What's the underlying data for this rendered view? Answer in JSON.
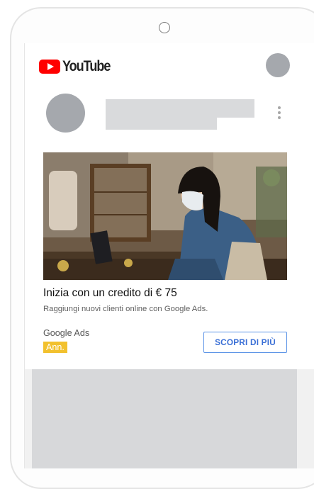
{
  "app": {
    "name": "YouTube"
  },
  "colors": {
    "brand_red": "#ff0000",
    "ad_badge": "#f2c12e",
    "cta_blue": "#3a6fd6",
    "placeholder": "#d9dadc"
  },
  "icons": [
    "youtube-logo-icon",
    "more-vert-icon"
  ],
  "ad": {
    "image_description_icon": "ad-photo",
    "headline": "Inizia con un credito di € 75",
    "description": "Raggiungi nuovi clienti online con Google Ads.",
    "advertiser": "Google Ads",
    "badge": "Ann.",
    "cta_label": "SCOPRI DI PIÙ"
  }
}
